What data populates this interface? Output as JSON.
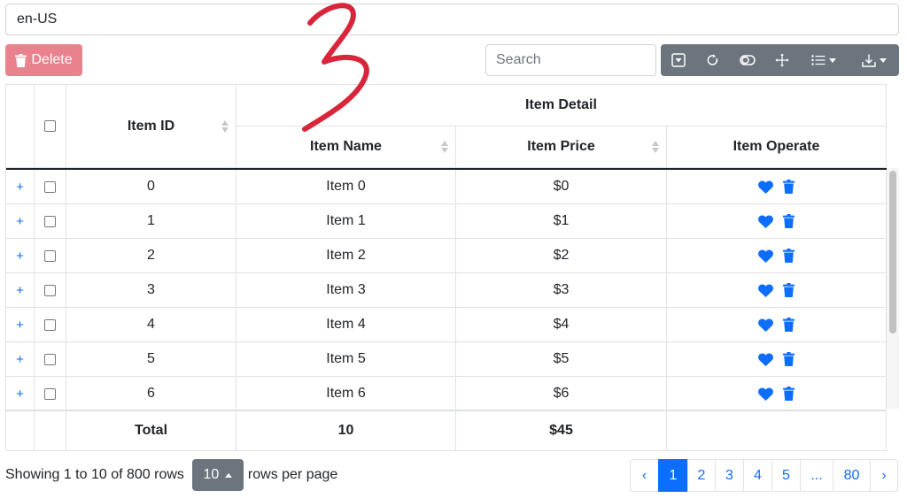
{
  "locale": {
    "value": "en-US"
  },
  "toolbar": {
    "delete_label": "Delete",
    "search_placeholder": "Search",
    "icons": [
      "filter-icon",
      "refresh-icon",
      "toggle-view-icon",
      "fullscreen-icon",
      "columns-icon",
      "export-icon"
    ]
  },
  "table": {
    "group_header": "Item Detail",
    "columns": {
      "id": "Item ID",
      "name": "Item Name",
      "price": "Item Price",
      "operate": "Item Operate"
    },
    "expander_symbol": "+",
    "rows": [
      {
        "id": "0",
        "name": "Item 0",
        "price": "$0"
      },
      {
        "id": "1",
        "name": "Item 1",
        "price": "$1"
      },
      {
        "id": "2",
        "name": "Item 2",
        "price": "$2"
      },
      {
        "id": "3",
        "name": "Item 3",
        "price": "$3"
      },
      {
        "id": "4",
        "name": "Item 4",
        "price": "$4"
      },
      {
        "id": "5",
        "name": "Item 5",
        "price": "$5"
      },
      {
        "id": "6",
        "name": "Item 6",
        "price": "$6"
      }
    ],
    "footer": {
      "label": "Total",
      "count": "10",
      "sum": "$45"
    }
  },
  "pagination": {
    "info": "Showing 1 to 10 of 800 rows",
    "page_size": "10",
    "rows_per_page": "rows per page",
    "prev": "‹",
    "pages": [
      "1",
      "2",
      "3",
      "4",
      "5",
      "...",
      "80"
    ],
    "next": "›",
    "active": "1"
  },
  "colors": {
    "primary": "#0d6efd",
    "secondary": "#6c757d",
    "danger": "#e4606d",
    "annotation": "#d8253a"
  }
}
